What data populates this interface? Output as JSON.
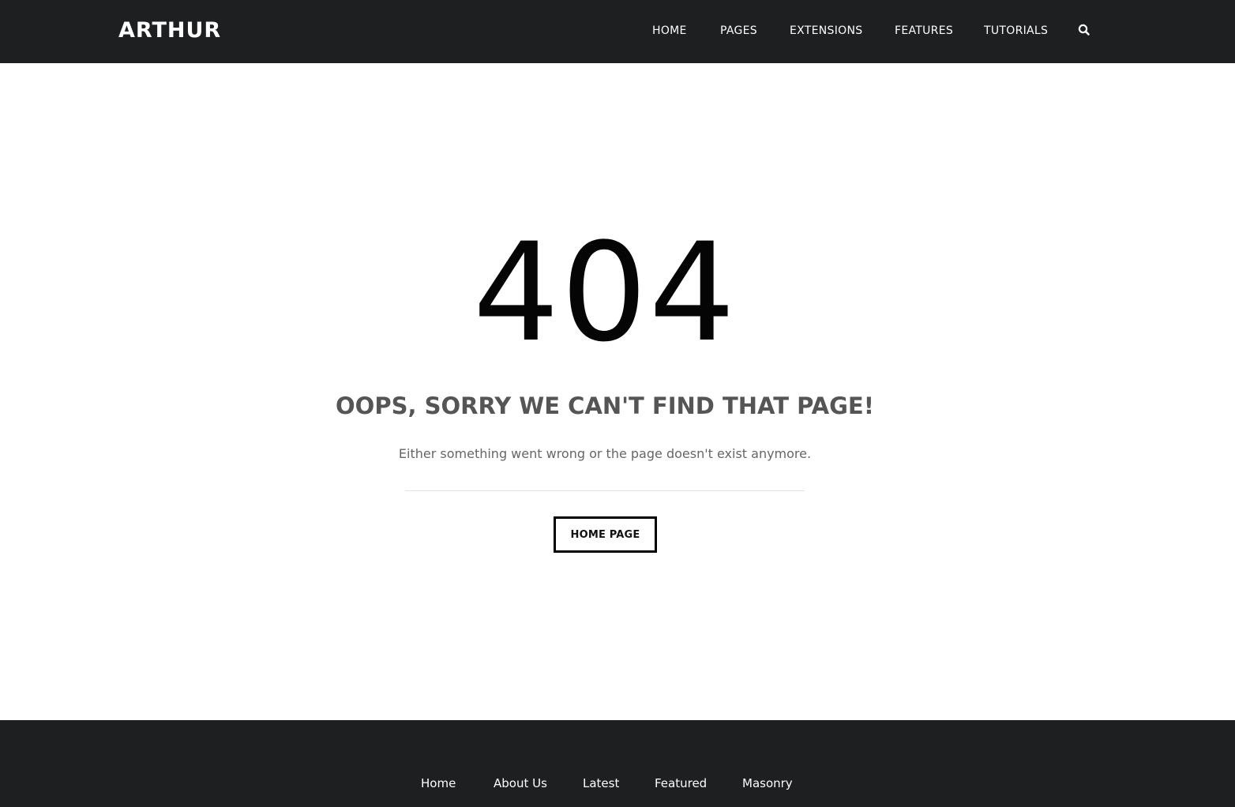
{
  "header": {
    "logo": "ARTHUR",
    "nav": [
      "HOME",
      "PAGES",
      "EXTENSIONS",
      "FEATURES",
      "TUTORIALS"
    ],
    "search_icon": "search-icon"
  },
  "main": {
    "code": "404",
    "headline": "OOPS, SORRY WE CAN'T FIND THAT PAGE!",
    "message": "Either something went wrong or the page doesn't exist anymore.",
    "button_label": "HOME PAGE"
  },
  "footer": {
    "links": [
      "Home",
      "About Us",
      "Latest",
      "Featured",
      "Masonry"
    ]
  },
  "colors": {
    "header_bg": "#1e1f21",
    "footer_bg": "#1e1f21",
    "text_dark": "#050505",
    "text_muted": "#555555"
  }
}
